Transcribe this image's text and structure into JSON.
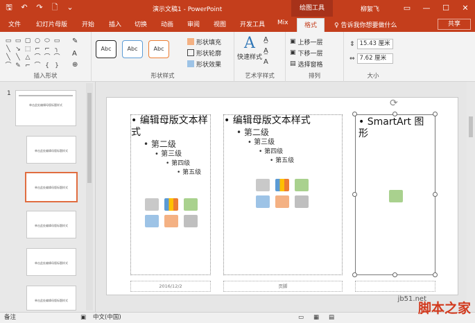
{
  "title_bar": {
    "quick_access": [
      {
        "name": "save-icon",
        "glyph": "🖫"
      },
      {
        "name": "undo-icon",
        "glyph": "↶"
      },
      {
        "name": "redo-icon",
        "glyph": "↷"
      },
      {
        "name": "new-file-icon",
        "glyph": "🗋"
      },
      {
        "name": "customize-qat-icon",
        "glyph": "⌄"
      }
    ],
    "title": "演示文稿1 - PowerPoint",
    "context_tools": "绘图工具",
    "user": "柳絮飞",
    "window_buttons": [
      {
        "name": "ribbon-display-icon",
        "glyph": "▭"
      },
      {
        "name": "minimize-icon",
        "glyph": "—"
      },
      {
        "name": "maximize-icon",
        "glyph": "☐"
      },
      {
        "name": "close-icon",
        "glyph": "✕"
      }
    ]
  },
  "tabs": [
    {
      "label": "文件",
      "name": "tab-file"
    },
    {
      "label": "幻灯片母版",
      "name": "tab-slide-master"
    },
    {
      "label": "开始",
      "name": "tab-home"
    },
    {
      "label": "插入",
      "name": "tab-insert"
    },
    {
      "label": "切换",
      "name": "tab-transitions"
    },
    {
      "label": "动画",
      "name": "tab-animations"
    },
    {
      "label": "审阅",
      "name": "tab-review"
    },
    {
      "label": "视图",
      "name": "tab-view"
    },
    {
      "label": "开发工具",
      "name": "tab-developer"
    },
    {
      "label": "Mix",
      "name": "tab-mix"
    },
    {
      "label": "格式",
      "name": "tab-format"
    }
  ],
  "tell_me": "♀ 告诉我你想要做什么",
  "share": "共享",
  "ribbon": {
    "insert_shapes": {
      "label": "插入形状",
      "shapes": [
        "▭",
        "▭",
        "▢",
        "○",
        "⬭",
        "▭",
        "╲",
        "↘",
        "⬚",
        "⌐",
        "⌐",
        "╮",
        "╲",
        "╲",
        "△",
        "⌒",
        "⌒",
        "⌒",
        "⌒",
        "✎",
        "⌐",
        "⌒",
        "{",
        "}"
      ]
    },
    "shape_styles": {
      "label": "形状样式",
      "preset_label": "Abc",
      "fill": "形状填充",
      "outline": "形状轮廓",
      "effects": "形状效果"
    },
    "wordart": {
      "label": "艺术字样式",
      "quick": "快速样式",
      "a_glyph": "A"
    },
    "arrange": {
      "label": "排列",
      "bring_forward": "上移一层",
      "send_backward": "下移一层",
      "selection_pane": "选择窗格"
    },
    "size": {
      "label": "大小",
      "height": "15.43 厘米",
      "width": "7.62 厘米"
    }
  },
  "thumbnails": {
    "slide_number": "1",
    "items": [
      {
        "caption": "单击此处编辑母版标题样式"
      },
      {
        "caption": "单击此处编辑母版标题样式"
      },
      {
        "caption": "单击此处编辑母版标题样式"
      },
      {
        "caption": "单击此处编辑母版标题样式"
      },
      {
        "caption": "单击此处编辑母版标题样式"
      },
      {
        "caption": "单击此处编辑母版标题样式"
      }
    ]
  },
  "slide": {
    "left_placeholder": {
      "lv0": "编辑母版文本样式",
      "lv1": "第二级",
      "lv2": "第三级",
      "lv3": "第四级",
      "lv4": "第五级"
    },
    "mid_placeholder": {
      "lv0": "编辑母版文本样式",
      "lv1": "第二级",
      "lv2": "第三级",
      "lv3": "第四级",
      "lv4": "第五级"
    },
    "smartart_placeholder": "SmartArt 图形",
    "footer_date": "2016/12/2",
    "footer_center": "页脚"
  },
  "status_bar": {
    "notes": "备注",
    "language": "中文(中国)"
  },
  "watermark": {
    "site": "jb51.net",
    "brand": "脚本之家"
  },
  "colors": {
    "accent": "#c43e1c",
    "selection": "#e06c3f"
  }
}
